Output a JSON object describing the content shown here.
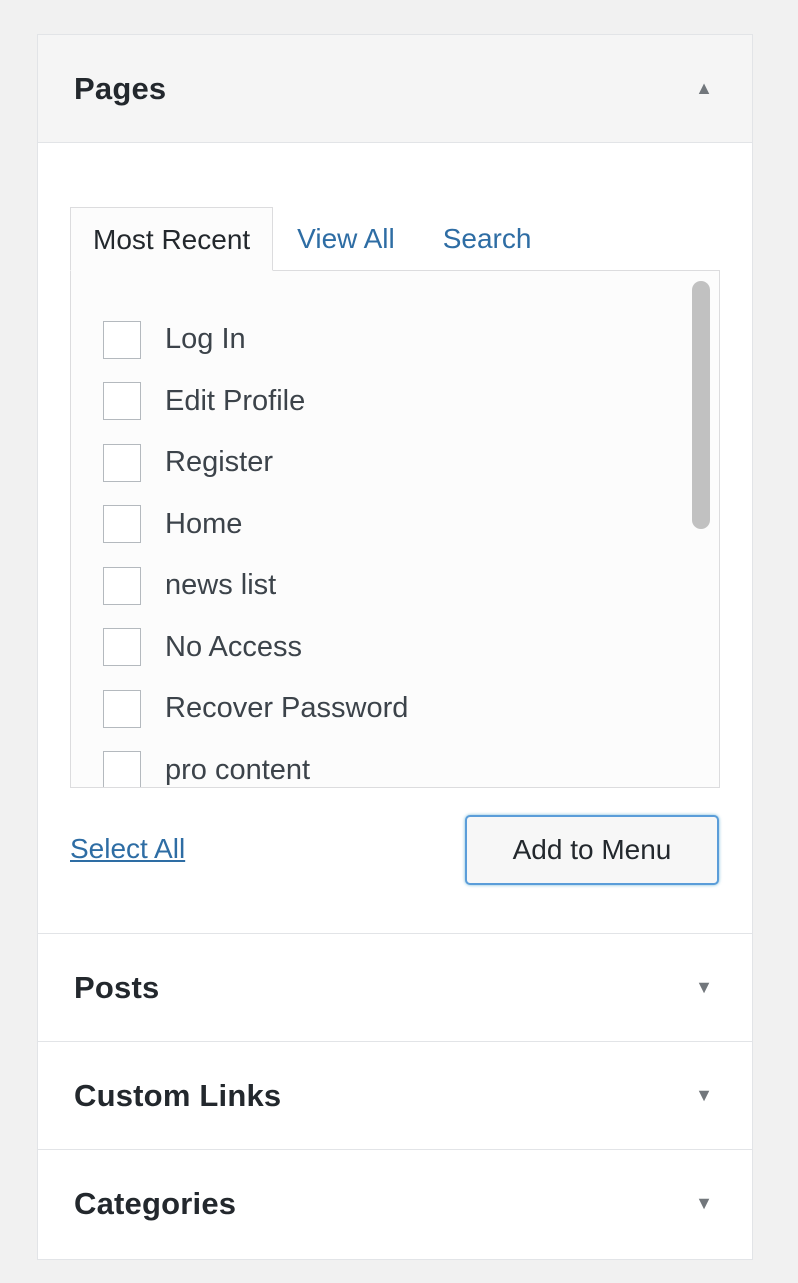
{
  "sections": {
    "pages": {
      "title": "Pages",
      "state": "expanded",
      "tabs": [
        {
          "label": "Most Recent",
          "active": true
        },
        {
          "label": "View All",
          "active": false
        },
        {
          "label": "Search",
          "active": false
        }
      ],
      "items": [
        {
          "label": "Log In",
          "checked": false
        },
        {
          "label": "Edit Profile",
          "checked": false
        },
        {
          "label": "Register",
          "checked": false
        },
        {
          "label": "Home",
          "checked": false
        },
        {
          "label": "news list",
          "checked": false
        },
        {
          "label": "No Access",
          "checked": false
        },
        {
          "label": "Recover Password",
          "checked": false
        },
        {
          "label": "pro content",
          "checked": false
        }
      ],
      "select_all_label": "Select All",
      "add_button_label": "Add to Menu"
    },
    "posts": {
      "title": "Posts",
      "state": "collapsed"
    },
    "custom_links": {
      "title": "Custom Links",
      "state": "collapsed"
    },
    "categories": {
      "title": "Categories",
      "state": "collapsed"
    }
  },
  "icons": {
    "expanded": "arrow-up-icon",
    "collapsed": "arrow-down-icon"
  },
  "colors": {
    "link": "#2e6da4",
    "button_focus_border": "#5b9dd9",
    "header_bg": "#f5f5f5",
    "page_bg": "#f1f1f1"
  }
}
